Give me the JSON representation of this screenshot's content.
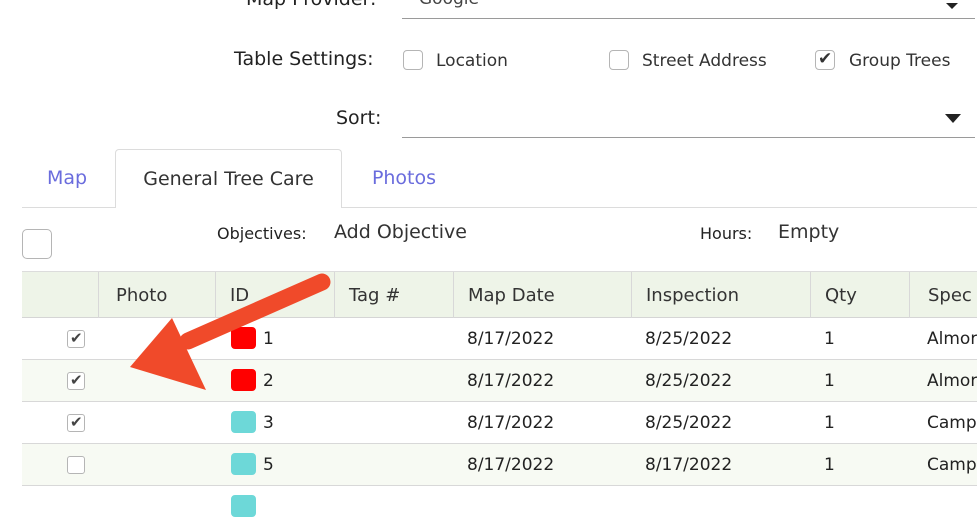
{
  "settings": {
    "map_provider_label": "Map Provider:",
    "map_provider_value": "Google",
    "table_settings_label": "Table Settings:",
    "options": [
      {
        "label": "Location",
        "checked": false
      },
      {
        "label": "Street Address",
        "checked": false
      },
      {
        "label": "Group Trees",
        "checked": true
      }
    ],
    "sort_label": "Sort:",
    "sort_value": ""
  },
  "tabs": [
    {
      "label": "Map",
      "active": false
    },
    {
      "label": "General Tree Care",
      "active": true
    },
    {
      "label": "Photos",
      "active": false
    }
  ],
  "summary": {
    "objectives_label": "Objectives:",
    "objectives_value": "Add Objective",
    "hours_label": "Hours:",
    "hours_value": "Empty"
  },
  "table": {
    "columns": [
      "",
      "Photo",
      "ID",
      "Tag #",
      "Map Date",
      "Inspection",
      "Qty",
      "Spec"
    ],
    "rows": [
      {
        "checked": true,
        "color": "#ff0000",
        "id": "1",
        "tag": "",
        "map_date": "8/17/2022",
        "inspection": "8/25/2022",
        "qty": "1",
        "species": "Almor"
      },
      {
        "checked": true,
        "color": "#ff0000",
        "id": "2",
        "tag": "",
        "map_date": "8/17/2022",
        "inspection": "8/25/2022",
        "qty": "1",
        "species": "Almor"
      },
      {
        "checked": true,
        "color": "#6dd8d8",
        "id": "3",
        "tag": "",
        "map_date": "8/17/2022",
        "inspection": "8/25/2022",
        "qty": "1",
        "species": "Camp"
      },
      {
        "checked": false,
        "color": "#6dd8d8",
        "id": "5",
        "tag": "",
        "map_date": "8/17/2022",
        "inspection": "8/17/2022",
        "qty": "1",
        "species": "Camp"
      }
    ]
  },
  "annotation": {
    "color": "#f04a2a",
    "arrow": "arrow-icon"
  },
  "check_glyph": "✔"
}
